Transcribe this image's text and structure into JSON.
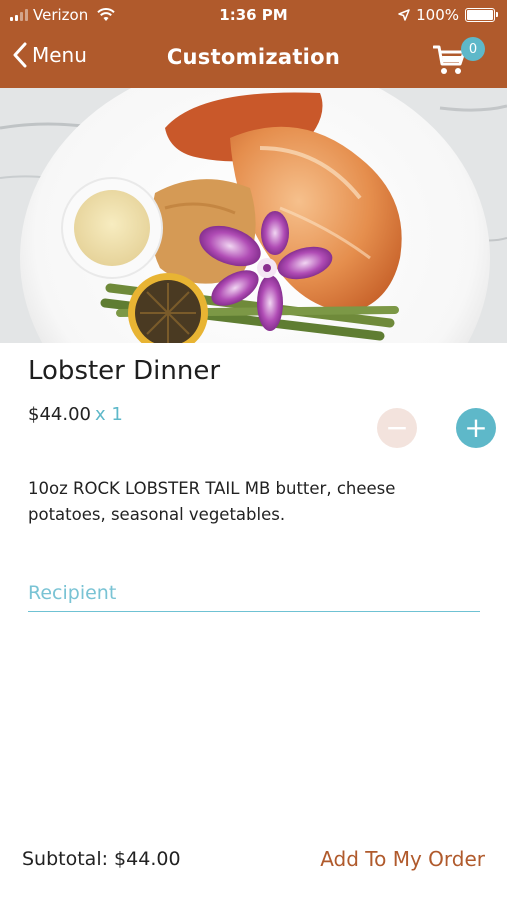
{
  "status_bar": {
    "carrier": "Verizon",
    "time": "1:36 PM",
    "battery": "100%",
    "battery_level": 1.0
  },
  "nav": {
    "back_label": "Menu",
    "title": "Customization",
    "cart_count": "0"
  },
  "item": {
    "name": "Lobster Dinner",
    "price": "$44.00",
    "quantity": "x 1",
    "description": "10oz ROCK LOBSTER TAIL  MB butter, cheese potatoes, seasonal vegetables.",
    "minus_label": "−",
    "plus_label": "+"
  },
  "recipient": {
    "placeholder": "Recipient",
    "value": ""
  },
  "footer": {
    "subtotal": "Subtotal: $44.00",
    "add_label": "Add To My Order"
  },
  "colors": {
    "header_bg": "#b05a2c",
    "accent": "#5eb8c9",
    "action_text": "#b05a2c"
  }
}
